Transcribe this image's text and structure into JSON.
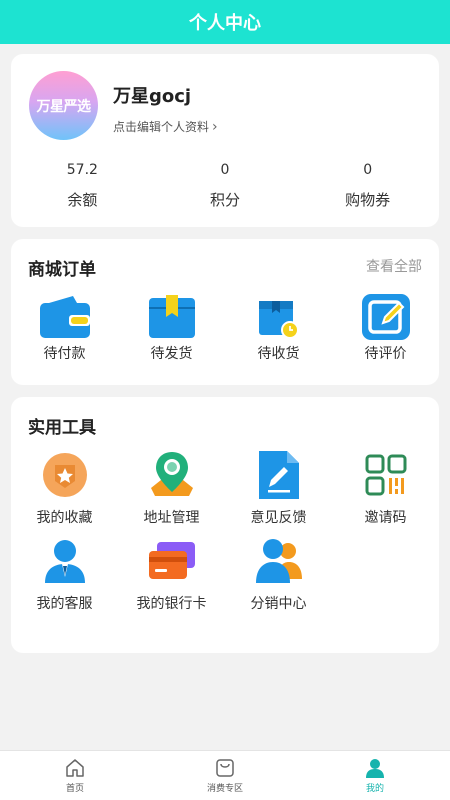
{
  "header": {
    "title": "个人中心"
  },
  "profile": {
    "avatar_text": "万星严选",
    "username": "万星gocj",
    "edit_hint": "点击编辑个人资料",
    "stats": [
      {
        "value": "57.2",
        "label": "余额"
      },
      {
        "value": "0",
        "label": "积分"
      },
      {
        "value": "0",
        "label": "购物券"
      }
    ]
  },
  "orders": {
    "title": "商城订单",
    "view_all": "查看全部",
    "items": [
      {
        "label": "待付款",
        "icon": "wallet-icon"
      },
      {
        "label": "待发货",
        "icon": "package-box-icon"
      },
      {
        "label": "待收货",
        "icon": "delivery-box-icon"
      },
      {
        "label": "待评价",
        "icon": "edit-review-icon"
      }
    ]
  },
  "tools": {
    "title": "实用工具",
    "items": [
      {
        "label": "我的收藏",
        "icon": "favorite-badge-icon"
      },
      {
        "label": "地址管理",
        "icon": "location-pin-icon"
      },
      {
        "label": "意见反馈",
        "icon": "feedback-document-icon"
      },
      {
        "label": "邀请码",
        "icon": "qr-code-icon"
      },
      {
        "label": "我的客服",
        "icon": "customer-service-icon"
      },
      {
        "label": "我的银行卡",
        "icon": "bank-card-icon"
      },
      {
        "label": "分销中心",
        "icon": "distribution-users-icon"
      }
    ]
  },
  "tabbar": {
    "items": [
      {
        "label": "首页",
        "icon": "home-icon"
      },
      {
        "label": "消费专区",
        "icon": "shopping-bag-icon"
      },
      {
        "label": "我的",
        "icon": "user-icon",
        "active": true
      }
    ]
  },
  "colors": {
    "accent": "#1de3d1",
    "active_tab": "#16b3ad",
    "icon_blue": "#1e95e6"
  }
}
